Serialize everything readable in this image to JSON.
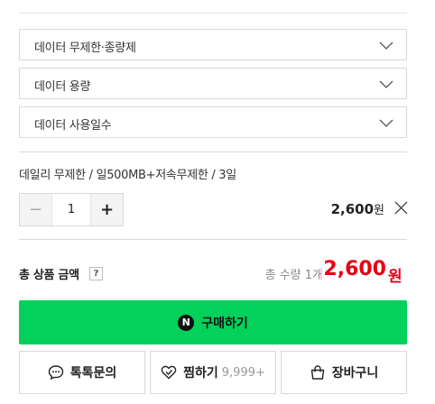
{
  "selects": [
    {
      "label": "데이터 무제한·종량제"
    },
    {
      "label": "데이터 용량"
    },
    {
      "label": "데이터 사용일수"
    }
  ],
  "selected_option": {
    "name": "데일리 무제한 / 일500MB+저속무제한 / 3일",
    "quantity": "1",
    "minus": "−",
    "plus": "+",
    "price": "2,600",
    "price_unit": "원"
  },
  "total": {
    "label": "총 상품 금액",
    "help": "?",
    "qty_text": "총 수량 1개",
    "price": "2,600",
    "price_unit": "원"
  },
  "buy": {
    "logo": "N",
    "label": "구매하기"
  },
  "actions": {
    "talk": "톡톡문의",
    "wish": "찜하기",
    "wish_count": "9,999+",
    "cart": "장바구니"
  },
  "colors": {
    "buy_bg": "#03d15c",
    "price_red": "#e60012"
  },
  "icons": [
    "chevron-down-icon",
    "close-icon",
    "naver-n-icon",
    "chat-icon",
    "heart-icon",
    "bag-icon"
  ]
}
